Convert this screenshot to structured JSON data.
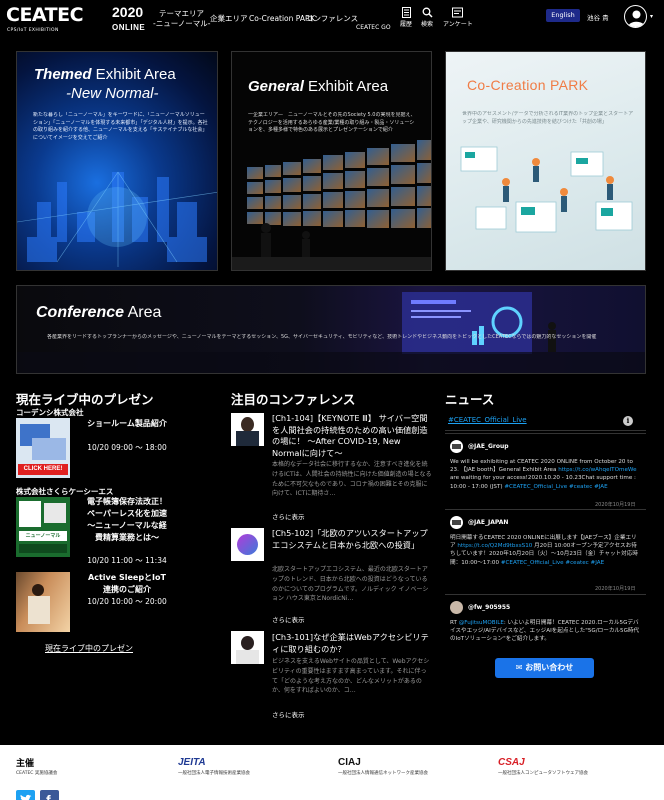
{
  "header": {
    "logo_text": "CEATEC",
    "logo_year": "2020",
    "logo_online": "ONLINE",
    "logo_sub": "CPS/IoT EXHIBITION",
    "nav": {
      "theme_line1": "テーマエリア",
      "theme_line2": "-ニューノーマル-",
      "company_area": "企業エリア",
      "cocreation": "Co-Creation PARK",
      "conference": "コンファレンス",
      "ceatec_go": "CEATEC GO",
      "history": "履歴",
      "search": "検索",
      "survey": "アンケート"
    },
    "language_button": "English",
    "user_name": "池谷 貴",
    "icons": {
      "history": "history-icon",
      "search": "search-icon",
      "survey": "survey-icon",
      "avatar": "user-avatar-icon"
    }
  },
  "tiles": {
    "themed": {
      "title_bold": "Themed",
      "title_rest": " Exhibit Area",
      "subtitle": "-New Normal-",
      "desc": "新たな暮らし「ニューノーマル」をキーワードに、「ニューノーマルソリューション」「ニューノーマルを体現する未来都市」「デジタル人材」を提示。各社の取り組みを紹介する他、ニューノーマルを支える「サステイナブルな社会」についてイメージを交えてご紹介"
    },
    "general": {
      "title_bold": "General",
      "title_rest": " Exhibit Area",
      "desc": "一企業エリア—　ニューノーマルとその先のSociety 5.0の実現を見据え、テクノロジーを活用するあらゆる産業/業種の取り組み・製品・ソリューションを、多種多様で特色のある展示とプレゼンテーションで紹介"
    },
    "cocreation": {
      "title": "Co-Creation PARK",
      "desc": "世界中のアセスメント/データで分析されるIT業界のトップ企業とスタートアップ企業や、研究機関からの先進技術を結びつけた「共創の場」"
    },
    "conference": {
      "title_bold": "Conference",
      "title_rest": " Area",
      "desc": "各産業界をリードするトップランナーからのメッセージや、ニューノーマルをテーマとするセッション、5G、サイバーセキュリティ、モビリティなど、技術トレンドやビジネス動向をトピックとしたCEATECならではの魅力的なセッションを開催"
    }
  },
  "live": {
    "heading": "現在ライブ中のプレゼン",
    "items": [
      {
        "company": "コーデンシ株式会社",
        "title": "ショールーム製品紹介",
        "time": "10/20 09:00 ～ 18:00",
        "thumb_caption": "CLICK HERE!"
      },
      {
        "company": "株式会社さくらケーシーエス",
        "title": "電子帳簿保存法改正！ペーパーレス化を加速～ニューノーマルな経費精算業務とは～",
        "time": "10/20 11:00 ～ 11:34",
        "thumb_caption": "ニューノーマル"
      },
      {
        "company": "",
        "title": "Active SleepとIoT連携のご紹介",
        "time": "10/20 10:00 ～ 20:00",
        "thumb_caption": ""
      }
    ],
    "more": "現在ライブ中のプレゼン"
  },
  "conferences": {
    "heading": "注目のコンファレンス",
    "items": [
      {
        "title": "[Ch1-104]【KEYNOTE Ⅲ】 サイバー空間を人間社会の持続性のための高い価値創造の場に！ ～After COVID-19, New Normalに向けて～",
        "desc": "本格的なデータ社会に移行するなか、注意すべき進化を続けるICTは、人間社会の持続性に向けた価値創造の場となるために不可欠なものであり、コロナ禍の困難とその克服に向けて、ICTに期待さ…",
        "more": "さらに表示"
      },
      {
        "title": "[Ch5-102]「北欧のアツいスタートアップエコシステムと日本から北欧への投資」",
        "desc": "北欧スタートアップエコシステム、最近の北欧スタートアップのトレンド、日本から北欧への投資はどうなっているのかについてのプログラムです。ノルディック イノベーション ハウス東京とNordicNi…",
        "more": "さらに表示"
      },
      {
        "title": "[Ch3-101]なぜ企業はWebアクセシビリティに取り組むのか？",
        "desc": "ビジネスを支えるWebサイトの品質として、Webアクセシビリティの重要性はますます高まっています。それに伴って「どのような考え方なのか、どんなメリットがあるのか、何をすればよいのか、コ…",
        "more": "さらに表示"
      }
    ]
  },
  "news": {
    "heading": "ニュース",
    "feed_link": "#CEATEC_Official_Live",
    "tweets": [
      {
        "user": "@JAE_Group",
        "text_plain": "We will be exhibiting at CEATEC 2020 ONLINE from October 20 to 23. 【JAE booth】General Exhibit Area ",
        "text_link": "https://t.co/wAhqeITOmeWe",
        "text_plain2": " are waiting for your access!2020.10.20 - 10.23Chat support time : 10:00 - 17:00 (JST) ",
        "text_tags": "#CEATEC_Official_Live #ceatec #JAE",
        "date": "2020年10月19日"
      },
      {
        "user": "@JAE_JAPAN",
        "text_plain": "明日開幕するCEATEC 2020 ONLINEに出展します【JAEブース】企業エリア ",
        "text_link": "https://t.co/Q2Md9tbxsS10",
        "text_plain2": " 月20日 10:00オープン予定アクセスお待ちしています！2020年10月20日（火）～10月23日（金）チャット対応時間：10:00～17:00 ",
        "text_tags": "#CEATEC_Official_Live #ceatec #JAE",
        "date": "2020年10月19日"
      },
      {
        "user": "@fw_905955",
        "text_plain": "RT ",
        "text_link": "@FujitsuMOBILE",
        "text_plain2": ": いよいよ明日開幕！CEATEC 2020.ローカル5Gデバイスやエッジ/AIデバイスなど、エッジAIを起点とした\"5G/ローカル5G時代のIoTソリューション\"をご紹介します。",
        "text_tags": "",
        "date": ""
      }
    ],
    "inquiry_button": "お問い合わせ"
  },
  "footer": {
    "heading": "主催",
    "orgs": [
      {
        "logo": "",
        "name": "CEATEC 実施協議会"
      },
      {
        "logo": "JEITA",
        "name": "一般社団法人電子情報技術産業協会"
      },
      {
        "logo": "CIAJ",
        "name": "一般社団法人情報通信ネットワーク産業協会"
      },
      {
        "logo": "CSAJ",
        "name": "一般社団法人コンピュータソフトウェア協会"
      }
    ],
    "social_icons": [
      "twitter-icon",
      "facebook-icon"
    ]
  },
  "colors": {
    "accent": "#1a73e8",
    "lang_bg": "#1e2a8a",
    "link": "#1da1f2",
    "tile_border": "#333333"
  }
}
